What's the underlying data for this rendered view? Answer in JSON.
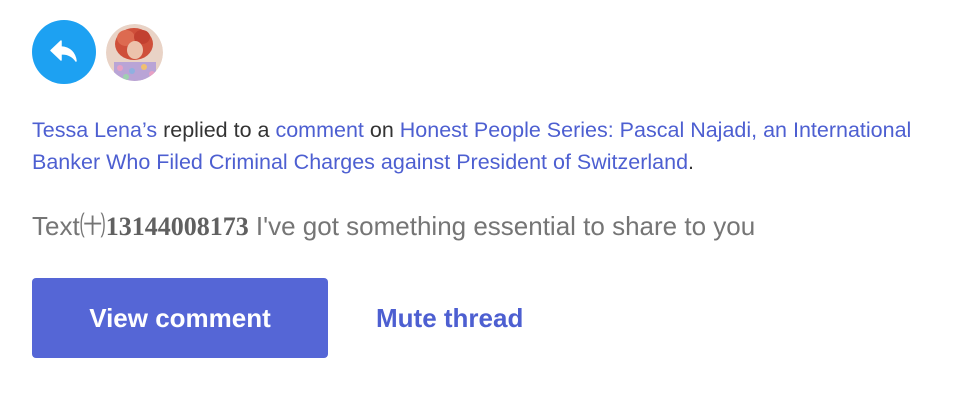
{
  "notification": {
    "actor": "Tessa Lena’s",
    "verb": "replied to a",
    "object": "comment",
    "preposition": "on",
    "post_title": "Honest People Series: Pascal Najadi, an International Banker Who Filed Criminal Charges against President of Switzerland",
    "end_punct": "."
  },
  "message": {
    "prefix": "Text㈩",
    "number": "13144008173",
    "body": " I've got something essential to share to you"
  },
  "actions": {
    "view_label": "View comment",
    "mute_label": "Mute thread"
  },
  "icons": {
    "reply": "reply-arrow-icon",
    "avatar": "user-avatar"
  },
  "colors": {
    "badge": "#1DA1F2",
    "link": "#4d5fd1",
    "button": "#5566d6"
  }
}
